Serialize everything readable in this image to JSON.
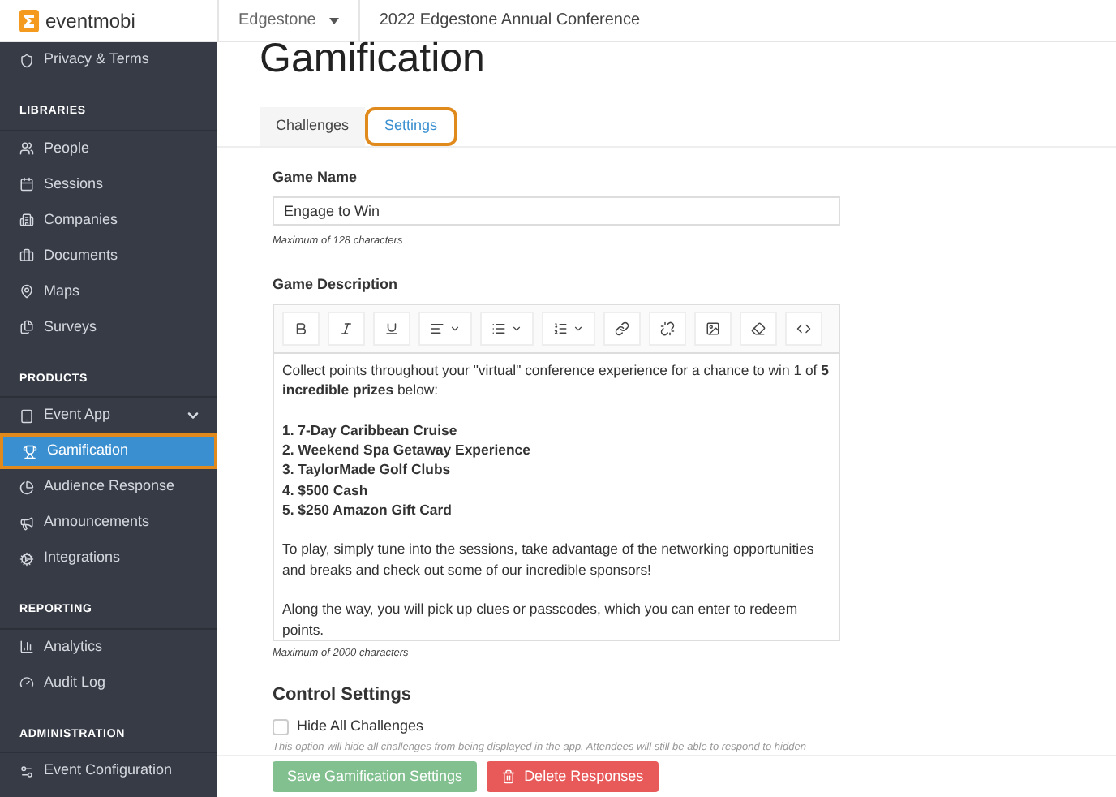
{
  "header": {
    "logo": "eventmobi",
    "organization": "Edgestone",
    "event": "2022 Edgestone Annual Conference"
  },
  "sidebar": {
    "sections": [
      {
        "items": [
          {
            "label": "Privacy & Terms",
            "selected": false,
            "kind": "link"
          }
        ]
      },
      {
        "heading": "LIBRARIES",
        "items": [
          {
            "label": "People",
            "selected": false,
            "kind": "link"
          },
          {
            "label": "Sessions",
            "selected": false,
            "kind": "link"
          },
          {
            "label": "Companies",
            "selected": false,
            "kind": "link"
          },
          {
            "label": "Documents",
            "selected": false,
            "kind": "link"
          },
          {
            "label": "Maps",
            "selected": false,
            "kind": "link"
          },
          {
            "label": "Surveys",
            "selected": false,
            "kind": "link"
          }
        ]
      },
      {
        "heading": "PRODUCTS",
        "items": [
          {
            "label": "Event App",
            "selected": false,
            "kind": "menu"
          },
          {
            "label": "Gamification",
            "selected": true,
            "kind": "link"
          },
          {
            "label": "Audience Response",
            "selected": false,
            "kind": "link"
          },
          {
            "label": "Announcements",
            "selected": false,
            "kind": "link"
          },
          {
            "label": "Integrations",
            "selected": false,
            "kind": "link"
          }
        ]
      },
      {
        "heading": "REPORTING",
        "items": [
          {
            "label": "Analytics",
            "selected": false,
            "kind": "link"
          },
          {
            "label": "Audit Log",
            "selected": false,
            "kind": "link"
          }
        ]
      },
      {
        "heading": "ADMINISTRATION",
        "items": [
          {
            "label": "Event Configuration",
            "selected": false,
            "kind": "link"
          }
        ]
      }
    ]
  },
  "page": {
    "title": "Gamification",
    "tabs": [
      {
        "label": "Challenges",
        "selected": false
      },
      {
        "label": "Settings",
        "selected": true
      }
    ],
    "game_name": {
      "label": "Game Name",
      "value": "Engage to Win",
      "hint": "Maximum of 128 characters"
    },
    "game_description": {
      "label": "Game Description",
      "hint": "Maximum of 2000 characters",
      "lines": [
        {
          "kind": "text",
          "text": "Collect points throughout your \"virtual\" conference experience for a chance to win 1 of **5 incredible prizes** below:"
        },
        {
          "kind": "blank"
        },
        {
          "kind": "bold",
          "text": "1. 7-Day Caribbean Cruise"
        },
        {
          "kind": "bold",
          "text": "2. Weekend Spa Getaway Experience"
        },
        {
          "kind": "bold",
          "text": "3. TaylorMade Golf Clubs"
        },
        {
          "kind": "bold",
          "text": "4. $500 Cash"
        },
        {
          "kind": "bold",
          "text": "5. $250 Amazon Gift Card"
        },
        {
          "kind": "blank"
        },
        {
          "kind": "text",
          "text": "To play, simply tune into the sessions, take advantage of the networking opportunities and breaks and check out some of our incredible sponsors!"
        },
        {
          "kind": "blank"
        },
        {
          "kind": "text",
          "text": "Along the way, you will pick up clues or passcodes, which you can enter to redeem points."
        }
      ]
    },
    "control_settings": {
      "heading": "Control Settings",
      "options": [
        {
          "label": "Hide All Challenges",
          "checked": false,
          "hint": "This option will hide all challenges from being displayed in the app. Attendees will still be able to respond to hidden"
        }
      ]
    },
    "buttons": [
      {
        "label": "Save Gamification Settings",
        "kind": "primary",
        "disabled": true
      },
      {
        "label": "Delete Responses",
        "kind": "danger",
        "disabled": false
      }
    ]
  }
}
